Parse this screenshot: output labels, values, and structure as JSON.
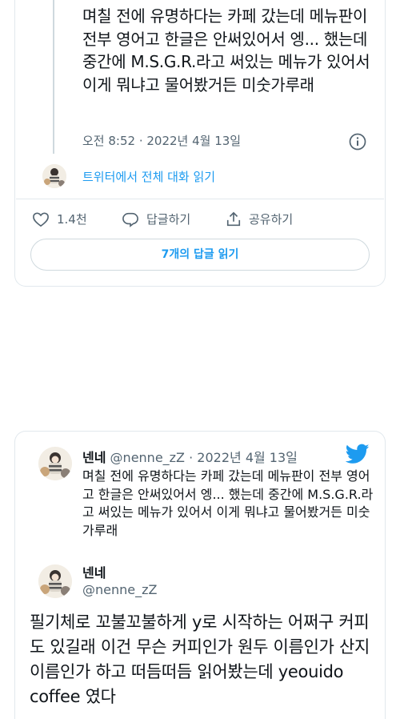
{
  "tweet1": {
    "text": "며칠 전에 유명하다는 카페 갔는데 메뉴판이 전부 영어고 한글은 안써있어서 엥... 했는데 중간에 M.S.G.R.라고 써있는 메뉴가 있어서 이게 뭐냐고 물어봤거든 미숫가루래",
    "timestamp": "오전 8:52 · 2022년 4월 13일",
    "read_thread": "트위터에서 전체 대화 읽기",
    "like_count": "1.4천",
    "reply_label": "답글하기",
    "share_label": "공유하기",
    "read_replies": "7개의 답글 읽기"
  },
  "tweet2": {
    "quoted": {
      "name": "넨네",
      "handle": "@nenne_zZ",
      "dot": "·",
      "date": "2022년 4월 13일",
      "text": "며칠 전에 유명하다는 카페 갔는데 메뉴판이 전부 영어고 한글은 안써있어서 엥... 했는데 중간에 M.S.G.R.라고 써있는 메뉴가 있어서 이게 뭐냐고 물어봤거든 미숫가루래"
    },
    "author": {
      "name": "넨네",
      "handle": "@nenne_zZ"
    },
    "text": "필기체로 꼬불꼬불하게 y로 시작하는 어쩌구 커피도 있길래 이건 무슨 커피인가 원두 이름인가 산지 이름인가 하고 떠듬떠듬 읽어봤는데 yeouido coffee 였다"
  },
  "colors": {
    "link": "#1d9bf0",
    "muted": "#536471",
    "text": "#0f1419",
    "border": "#e1e8ed"
  }
}
